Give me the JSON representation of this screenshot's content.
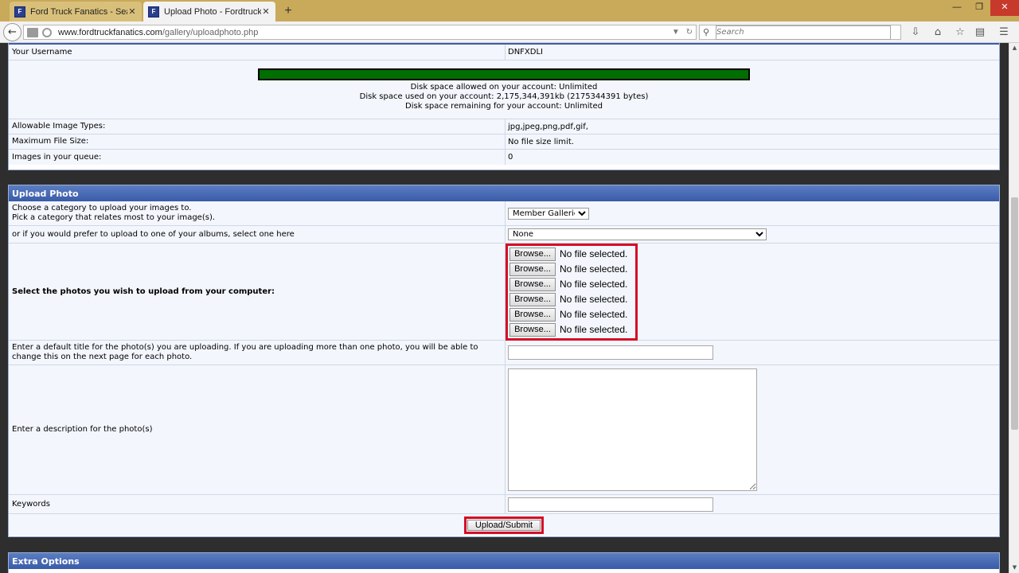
{
  "browser": {
    "tabs": [
      {
        "title": "Ford Truck Fanatics - Searc...",
        "active": false,
        "close": "✕"
      },
      {
        "title": "Upload Photo - Fordtruckf...",
        "active": true,
        "close": "✕"
      }
    ],
    "new_tab": "+",
    "window_controls": [
      "—",
      "❐",
      "✕"
    ],
    "url_host": "www.fordtruckfanatics.com",
    "url_path": "/gallery/uploadphoto.php",
    "search_placeholder": "Search",
    "icons": [
      "back-icon",
      "reader-icon",
      "globe-icon",
      "dropdown-icon",
      "reload-icon",
      "search-icon",
      "download-icon",
      "home-icon",
      "bookmark-star-icon",
      "reading-list-icon",
      "menu-icon"
    ]
  },
  "account": {
    "username_label": "Your Username",
    "username": "DNFXDLI",
    "disk_allowed": "Disk space allowed on your account: Unlimited",
    "disk_used": "Disk space used on your account: 2,175,344,391kb (2175344391 bytes)",
    "disk_remaining": "Disk space remaining for your account: Unlimited",
    "disk_usage_fraction": 1.0,
    "types_label": "Allowable Image Types:",
    "types_value": "jpg,jpeg,png,pdf,gif,",
    "maxsize_label": "Maximum File Size:",
    "maxsize_value": "No file size limit.",
    "queue_label": "Images in your queue:",
    "queue_value": "0"
  },
  "upload": {
    "heading": "Upload Photo",
    "category_label_1": "Choose a category to upload your images to.",
    "category_label_2": "Pick a category that relates most to your image(s).",
    "category_selected": "Member Galleries",
    "album_label": "or if you would prefer to upload to one of your albums, select one here",
    "album_selected": "None",
    "files_label": "Select the photos you wish to upload from your computer:",
    "browse_label": "Browse...",
    "no_file": "No file selected.",
    "title_label": "Enter a default title for the photo(s) you are uploading. If you are uploading more than one photo, you will be able to change this on the next page for each photo.",
    "description_label": "Enter a description for the photo(s)",
    "keywords_label": "Keywords",
    "submit_label": "Upload/Submit"
  },
  "extra": {
    "heading": "Extra Options"
  }
}
